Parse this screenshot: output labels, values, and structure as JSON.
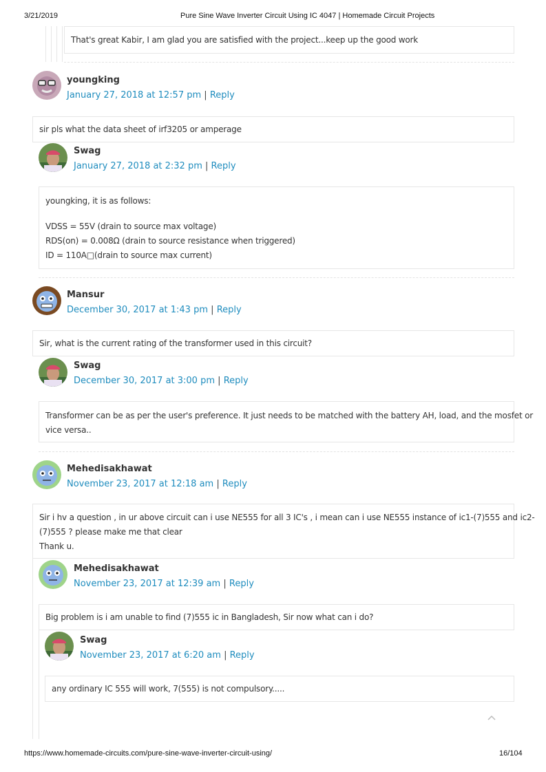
{
  "header": {
    "date": "3/21/2019",
    "title": "Pure Sine Wave Inverter Circuit Using IC 4047 | Homemade Circuit Projects"
  },
  "footer": {
    "url": "https://www.homemade-circuits.com/pure-sine-wave-inverter-circuit-using/",
    "page": "16/104"
  },
  "reply_label": "Reply",
  "separator": "|",
  "comments": [
    {
      "text": [
        "That's great Kabir, I am glad you are satisfied with the project...keep up the good work"
      ]
    },
    {
      "author": "youngking",
      "date": "January 27, 2018 at 12:57 pm",
      "text": [
        "sir pls what the data sheet of irf3205 or amperage"
      ]
    },
    {
      "author": "Swag",
      "date": "January 27, 2018 at 2:32 pm",
      "text": [
        "youngking, it is as follows:",
        "",
        "VDSS = 55V (drain to source max voltage)",
        "RDS(on) = 0.008Ω (drain to source resistance when triggered)",
        "ID = 110A□(drain to source max current)"
      ]
    },
    {
      "author": "Mansur",
      "date": "December 30, 2017 at 1:43 pm",
      "text": [
        "Sir, what is the current rating of the transformer used in this circuit?"
      ]
    },
    {
      "author": "Swag",
      "date": "December 30, 2017 at 3:00 pm",
      "text": [
        "Transformer can be as per the user's preference. It just needs to be matched with the battery AH, load, and the mosfet or",
        "vice versa.."
      ]
    },
    {
      "author": "Mehedisakhawat",
      "date": "November 23, 2017 at 12:18 am",
      "text": [
        "Sir i hv a question , in ur above circuit can i use NE555 for all 3 IC's , i mean can i use NE555 instance of ic1-(7)555 and ic2-",
        "(7)555 ? please make me that clear",
        "Thank u."
      ]
    },
    {
      "author": "Mehedisakhawat",
      "date": "November 23, 2017 at 12:39 am",
      "text": [
        "Big problem is i am unable to find (7)555 ic in Bangladesh, Sir now what can i do?"
      ]
    },
    {
      "author": "Swag",
      "date": "November 23, 2017 at 6:20 am",
      "text": [
        "any ordinary IC 555 will work, 7(555) is not compulsory....."
      ]
    }
  ]
}
